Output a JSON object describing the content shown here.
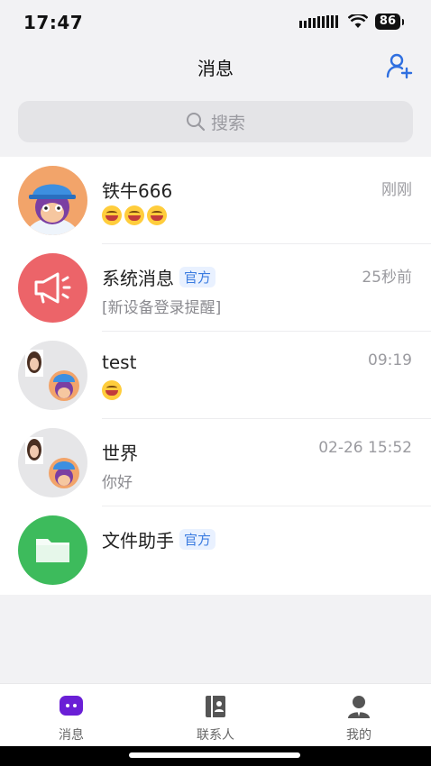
{
  "status": {
    "time": "17:47",
    "battery": "86"
  },
  "header": {
    "title": "消息"
  },
  "search": {
    "placeholder": "搜索"
  },
  "conversations": [
    {
      "name": "铁牛666",
      "time": "刚刚",
      "preview": "",
      "emojis": 3
    },
    {
      "name": "系统消息",
      "tag": "官方",
      "time": "25秒前",
      "preview": "[新设备登录提醒]"
    },
    {
      "name": "test",
      "time": "09:19",
      "preview": "",
      "emojis": 1
    },
    {
      "name": "世界",
      "time": "02-26 15:52",
      "preview": "你好"
    },
    {
      "name": "文件助手",
      "tag": "官方",
      "time": "",
      "preview": ""
    }
  ],
  "tabbar": {
    "tabs": [
      {
        "label": "消息"
      },
      {
        "label": "联系人"
      },
      {
        "label": "我的"
      }
    ]
  },
  "colors": {
    "accent": "#6a1fd6",
    "tag": "#3a7be0",
    "system_avatar": "#ec6469",
    "file_avatar": "#3dbb5c"
  }
}
